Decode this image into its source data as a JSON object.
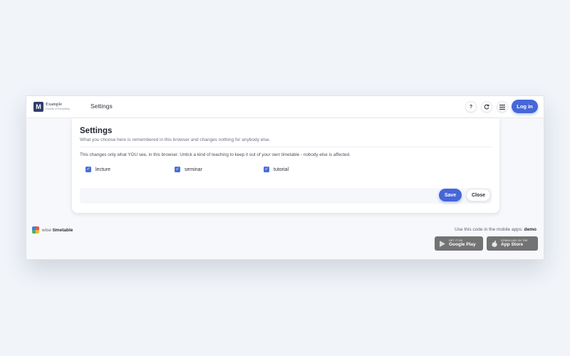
{
  "header": {
    "logo_letter": "M",
    "brand_name": "Example",
    "brand_sub": "Faculty of Everything",
    "page_title": "Settings",
    "help_label": "?",
    "login_label": "Log in"
  },
  "settings": {
    "title": "Settings",
    "subtitle": "What you choose here is remembered in this browser and changes nothing for anybody else.",
    "description": "This changes only what YOU see, in this browser. Untick a kind of teaching to keep it out of your own timetable - nobody else is affected.",
    "options": [
      {
        "label": "lecture",
        "checked": true
      },
      {
        "label": "seminar",
        "checked": true
      },
      {
        "label": "tutorial",
        "checked": true
      }
    ],
    "save_label": "Save",
    "close_label": "Close"
  },
  "footer": {
    "app_name_prefix": "wise",
    "app_name_bold": "timetable",
    "mobile_text": "Use this code in the mobile apps:",
    "mobile_code": "demo",
    "google_small": "GET IT ON",
    "google_big": "Google Play",
    "apple_small": "DOWNLOAD ON THE",
    "apple_big": "App Store"
  },
  "colors": {
    "accent": "#4667d8",
    "logo_bg": "#2f3d6c",
    "badge_bg": "#737373"
  }
}
